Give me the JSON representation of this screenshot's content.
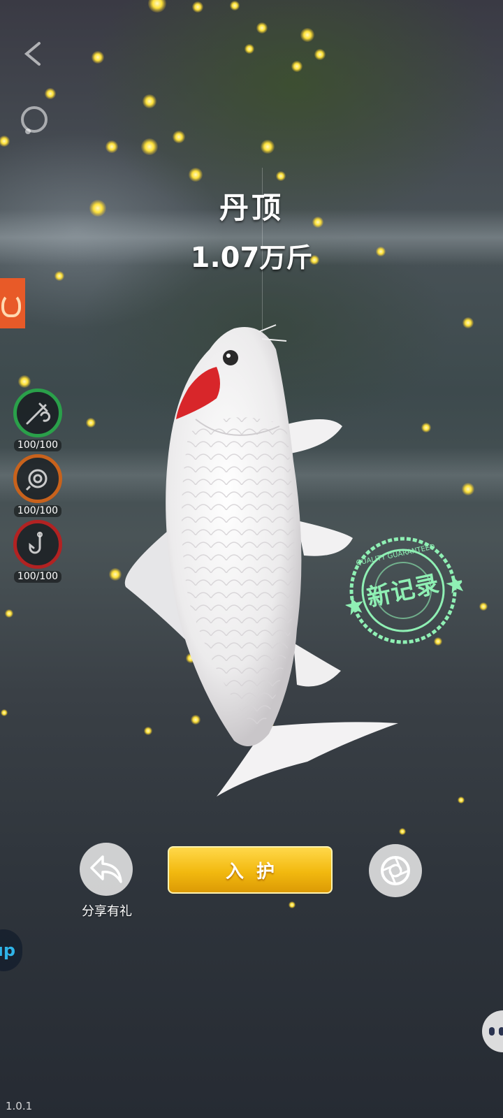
{
  "fish": {
    "name": "丹顶",
    "weight_number": "1.07",
    "weight_unit": "万斤",
    "record_badge": "新记录",
    "badge_ring_text": "QUALITY GUARANTEED"
  },
  "gear": [
    {
      "icon": "fishing-rod-icon",
      "durability": "100/100",
      "ring_color": "#2aa04a"
    },
    {
      "icon": "fishing-reel-icon",
      "durability": "100/100",
      "ring_color": "#c8621c"
    },
    {
      "icon": "fish-hook-icon",
      "durability": "100/100",
      "ring_color": "#b22222"
    }
  ],
  "actions": {
    "share_label": "分享有礼",
    "keep_label": "入护"
  },
  "side": {
    "edge_tab_text": "up"
  },
  "version": "1.0.1",
  "colors": {
    "keep_button": "#f2b90f",
    "firefly": "#ffe23a",
    "stamp": "#8ff0b4",
    "fish_crown": "#d8262a"
  }
}
